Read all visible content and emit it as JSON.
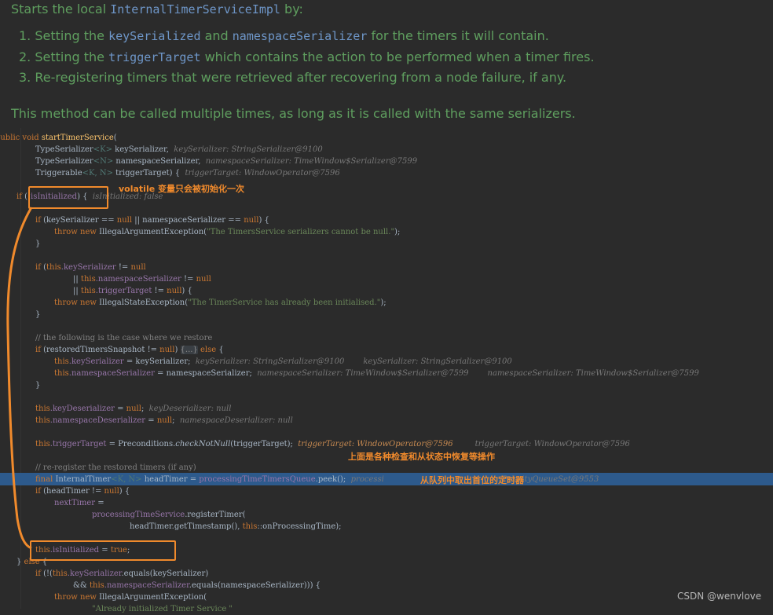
{
  "doc": {
    "title_before": "Starts the local ",
    "title_code": "InternalTimerServiceImpl",
    "title_after": " by:",
    "items": [
      {
        "n": "1.",
        "a": "Setting the ",
        "c1": "keySerialized",
        "b": " and ",
        "c2": "namespaceSerializer",
        "d": " for the timers it will contain."
      },
      {
        "n": "2.",
        "a": "Setting the ",
        "c1": "triggerTarget",
        "b": " which contains the action to be performed when a timer fires.",
        "c2": "",
        "d": ""
      },
      {
        "n": "3.",
        "a": "Re-registering timers that were retrieved after recovering from a node failure, if any.",
        "c1": "",
        "b": "",
        "c2": "",
        "d": ""
      }
    ],
    "paragraph": "This method can be called multiple times, as long as it is called with the same serializers."
  },
  "code": {
    "l1_kw": "public void ",
    "l1_fn": "startTimerService",
    "l1_end": "(",
    "l2_t": "TypeSerializer",
    "l2_g": "<K>",
    "l2_r": " keySerializer,  ",
    "l2_h": "keySerializer: StringSerializer@9100",
    "l3_t": "TypeSerializer",
    "l3_g": "<N>",
    "l3_r": " namespaceSerializer,  ",
    "l3_h": "namespaceSerializer: TimeWindow$Serializer@7599",
    "l4_t": "Triggerable",
    "l4_g": "<K, N>",
    "l4_r": " triggerTarget) {  ",
    "l4_h": "triggerTarget: WindowOperator@7596",
    "l5_kw": "if ",
    "l5_r": "(!",
    "l5_f": "isInitialized",
    "l5_e": ") {  ",
    "l5_h": "isInitialized: false",
    "l6_kw": "if ",
    "l6_r": "(keySerializer == ",
    "l6_n1": "null",
    "l6_r2": " || namespaceSerializer == ",
    "l6_n2": "null",
    "l6_e": ") {",
    "l7_kw": "throw new ",
    "l7_r": "IllegalArgumentException(",
    "l7_s": "\"The TimersService serializers cannot be null.\"",
    "l7_e": ");",
    "brace": "}",
    "l8_kw": "if ",
    "l8_r": "(",
    "l8_this": "this",
    "l8_f": ".keySerializer",
    "l8_e": " != ",
    "l8_n": "null",
    "l9_or": "|| ",
    "l9_this": "this",
    "l9_f": ".namespaceSerializer",
    "l9_e": " != ",
    "l9_n": "null",
    "l10_or": "|| ",
    "l10_this": "this",
    "l10_f": ".triggerTarget",
    "l10_e": " != ",
    "l10_n": "null",
    "l10_x": ") {",
    "l11_kw": "throw new ",
    "l11_r": "IllegalStateException(",
    "l11_s": "\"The TimerService has already been initialised.\"",
    "l11_e": ");",
    "l12_c": "// the following is the case where we restore",
    "l13_kw": "if ",
    "l13_r": "(restoredTimersSnapshot != ",
    "l13_n": "null",
    "l13_e": ") ",
    "l13_fold": "{...}",
    "l13_kw2": " else ",
    "l13_x": "{",
    "l14_this": "this",
    "l14_f": ".keySerializer",
    "l14_r": " = keySerializer;  ",
    "l14_h1": "keySerializer: StringSerializer@9100",
    "l14_h2": "keySerializer: StringSerializer@9100",
    "l15_this": "this",
    "l15_f": ".namespaceSerializer",
    "l15_r": " = namespaceSerializer;  ",
    "l15_h1": "namespaceSerializer: TimeWindow$Serializer@7599",
    "l15_h2": "namespaceSerializer: TimeWindow$Serializer@7599",
    "l16_this": "this",
    "l16_f": ".keyDeserializer",
    "l16_r": " = ",
    "l16_n": "null",
    "l16_e": ";  ",
    "l16_h": "keyDeserializer: null",
    "l17_this": "this",
    "l17_f": ".namespaceDeserializer",
    "l17_r": " = ",
    "l17_n": "null",
    "l17_e": ";  ",
    "l17_h": "namespaceDeserializer: null",
    "l18_this": "this",
    "l18_f": ".triggerTarget",
    "l18_r": " = Preconditions.",
    "l18_m": "checkNotNull",
    "l18_e": "(triggerTarget);  ",
    "l18_h1": "triggerTarget: WindowOperator@7596",
    "l18_h2": "triggerTarget: WindowOperator@7596",
    "l19_c": "// re-register the restored timers (if any)",
    "l20_kw": "final ",
    "l20_t": "InternalTimer",
    "l20_g": "<K, N>",
    "l20_r": " headTimer = ",
    "l20_f": "processingTimeTimersQueue",
    "l20_e": ".peek();  ",
    "l20_h1": "processi",
    "l20_h2": "PriorityQueueSet@9553",
    "l21_kw": "if ",
    "l21_r": "(headTimer != ",
    "l21_n": "null",
    "l21_e": ") {",
    "l22_f": "nextTimer",
    "l22_r": " =",
    "l23_f": "processingTimeService",
    "l23_r": ".registerTimer(",
    "l24_r": "headTimer.getTimestamp(), ",
    "l24_this": "this",
    "l24_e": "::onProcessingTime);",
    "l25_this": "this",
    "l25_f": ".isInitialized",
    "l25_r": " = ",
    "l25_t": "true",
    "l25_e": ";",
    "l26_r": "} ",
    "l26_kw": "else",
    "l26_e": " {",
    "l27_kw": "if ",
    "l27_r": "(!(",
    "l27_this": "this",
    "l27_f": ".keySerializer",
    "l27_e": ".equals(keySerializer)",
    "l28_r": "&& ",
    "l28_this": "this",
    "l28_f": ".namespaceSerializer",
    "l28_e": ".equals(namespaceSerializer))) {",
    "l29_kw": "throw new ",
    "l29_r": "IllegalArgumentException(",
    "l30_s": "\"Already initialized Timer Service \""
  },
  "annotations": {
    "volatile_note": "volatile 变量只会被初始化一次",
    "check_note": "上面是各种检查和从状态中恢复等操作",
    "queue_note": "从队列中取出首位的定时器",
    "accent": "#f08a2c"
  },
  "watermark": "CSDN @wenvlove"
}
